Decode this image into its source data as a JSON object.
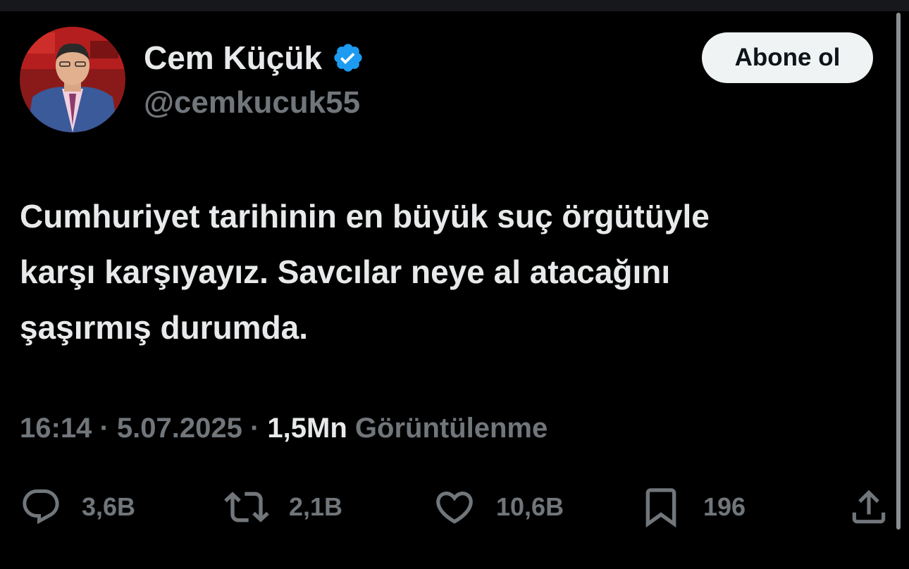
{
  "author": {
    "display_name": "Cem Küçük",
    "handle": "@cemkucuk55",
    "verified": true,
    "verified_color": "#1d9bf0"
  },
  "subscribe_button": {
    "label": "Abone ol"
  },
  "tweet": {
    "lines": [
      "Cumhuriyet tarihinin en büyük suç örgütüyle",
      "karşı karşıyayız. Savcılar neye al atacağını",
      "şaşırmış durumda."
    ]
  },
  "meta": {
    "time": "16:14",
    "separator": "·",
    "date": "5.07.2025",
    "views_count": "1,5Mn",
    "views_label": "Görüntülenme"
  },
  "actions": {
    "replies": {
      "icon": "reply-icon",
      "count": "3,6B"
    },
    "reposts": {
      "icon": "repost-icon",
      "count": "2,1B"
    },
    "likes": {
      "icon": "heart-icon",
      "count": "10,6B"
    },
    "bookmarks": {
      "icon": "bookmark-icon",
      "count": "196"
    },
    "share": {
      "icon": "share-icon"
    }
  },
  "colors": {
    "background": "#000000",
    "text_primary": "#e7e9ea",
    "text_secondary": "#71767b",
    "button_bg": "#eff3f4"
  }
}
